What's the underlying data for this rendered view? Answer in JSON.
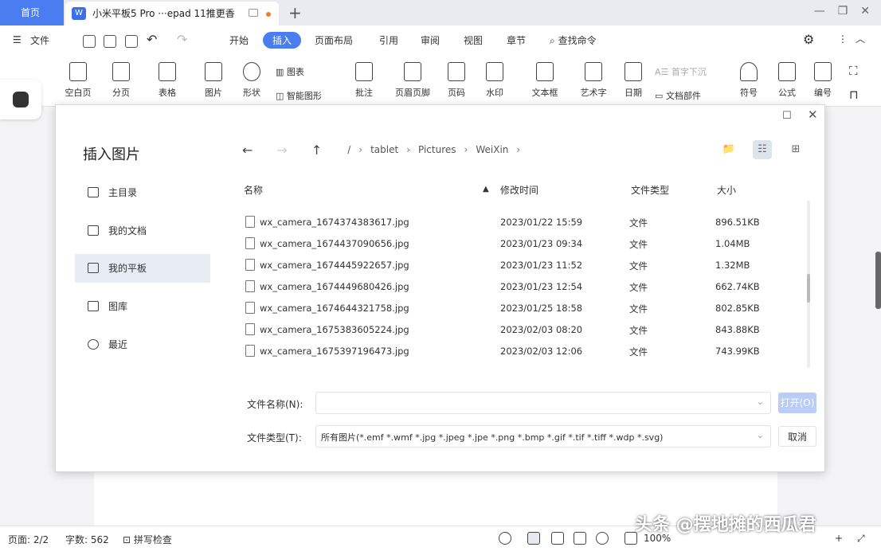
{
  "tabs": {
    "home_label": "首页",
    "doc_title": "小米平板5 Pro ···epad 11推更香",
    "doc_icon_text": "W"
  },
  "menu": {
    "file": "文件",
    "items": [
      "开始",
      "插入",
      "页面布局",
      "引用",
      "审阅",
      "视图",
      "章节"
    ],
    "active": "插入",
    "search": "查找命令"
  },
  "ribbon": {
    "buttons": [
      "空白页",
      "分页",
      "表格",
      "图片",
      "形状",
      "批注",
      "页眉页脚",
      "页码",
      "水印",
      "文本框",
      "艺术字",
      "日期",
      "符号",
      "公式",
      "编号"
    ],
    "chart": "图表",
    "smart_shape": "智能图形",
    "first_drop": "首字下沉",
    "doc_parts": "文档部件"
  },
  "dialog": {
    "title": "插入图片",
    "nav": [
      {
        "label": "主目录",
        "icon": "home-icon"
      },
      {
        "label": "我的文档",
        "icon": "documents-icon"
      },
      {
        "label": "我的平板",
        "icon": "folder-icon"
      },
      {
        "label": "图库",
        "icon": "gallery-icon"
      },
      {
        "label": "最近",
        "icon": "clock-icon"
      }
    ],
    "active_nav": "我的平板",
    "path": [
      "/",
      "tablet",
      "Pictures",
      "WeiXin"
    ],
    "columns": {
      "name": "名称",
      "modified": "修改时间",
      "type": "文件类型",
      "size": "大小"
    },
    "files": [
      {
        "name": "wx_camera_1674374383617.jpg",
        "modified": "2023/01/22 15:59",
        "type": "文件",
        "size": "896.51KB"
      },
      {
        "name": "wx_camera_1674437090656.jpg",
        "modified": "2023/01/23 09:34",
        "type": "文件",
        "size": "1.04MB"
      },
      {
        "name": "wx_camera_1674445922657.jpg",
        "modified": "2023/01/23 11:52",
        "type": "文件",
        "size": "1.32MB"
      },
      {
        "name": "wx_camera_1674449680426.jpg",
        "modified": "2023/01/23 12:54",
        "type": "文件",
        "size": "662.74KB"
      },
      {
        "name": "wx_camera_1674644321758.jpg",
        "modified": "2023/01/25 18:58",
        "type": "文件",
        "size": "802.85KB"
      },
      {
        "name": "wx_camera_1675383605224.jpg",
        "modified": "2023/02/03 08:20",
        "type": "文件",
        "size": "843.88KB"
      },
      {
        "name": "wx_camera_1675397196473.jpg",
        "modified": "2023/02/03 12:06",
        "type": "文件",
        "size": "743.99KB"
      }
    ],
    "filename_label": "文件名称(N):",
    "filename_value": "",
    "filetype_label": "文件类型(T):",
    "filetype_value": "所有图片(*.emf *.wmf *.jpg *.jpeg *.jpe *.png *.bmp *.gif *.tif *.tiff *.wdp *.svg)",
    "open_button": "打开(O)",
    "cancel_button": "取消"
  },
  "status": {
    "page": "页面: 2/2",
    "words": "字数: 562",
    "spell": "拼写检查",
    "zoom": "100%"
  },
  "watermark": "头条 @摆地摊的西瓜君",
  "colors": {
    "accent": "#4a7df0",
    "open_disabled": "#b9cdf7",
    "nav_active": "#e7ecf5"
  }
}
